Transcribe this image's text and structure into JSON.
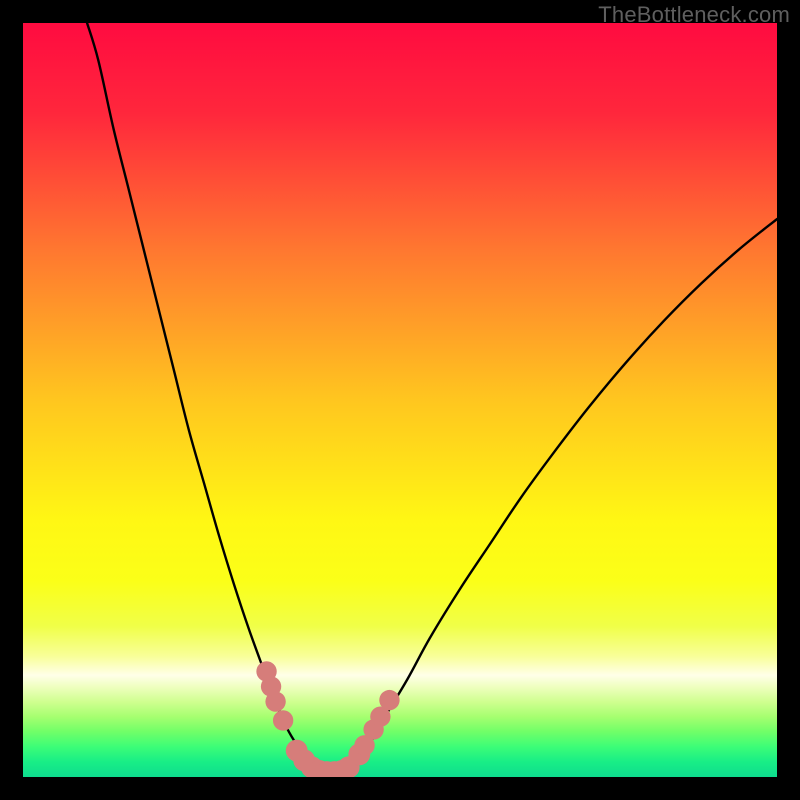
{
  "watermark": "TheBottleneck.com",
  "chart_data": {
    "type": "line",
    "title": "",
    "xlabel": "",
    "ylabel": "",
    "xlim": [
      0,
      100
    ],
    "ylim": [
      0,
      100
    ],
    "gradient_stops": [
      {
        "pct": 0,
        "color": "#ff0b40"
      },
      {
        "pct": 12,
        "color": "#ff273c"
      },
      {
        "pct": 30,
        "color": "#ff7730"
      },
      {
        "pct": 50,
        "color": "#ffc61f"
      },
      {
        "pct": 66,
        "color": "#fff714"
      },
      {
        "pct": 74,
        "color": "#fbff18"
      },
      {
        "pct": 80,
        "color": "#f0ff48"
      },
      {
        "pct": 84,
        "color": "#f8ff99"
      },
      {
        "pct": 86.5,
        "color": "#ffffe8"
      },
      {
        "pct": 88,
        "color": "#efffc0"
      },
      {
        "pct": 90,
        "color": "#d0ff90"
      },
      {
        "pct": 92,
        "color": "#a6ff70"
      },
      {
        "pct": 94,
        "color": "#70ff68"
      },
      {
        "pct": 96,
        "color": "#3cfd77"
      },
      {
        "pct": 98,
        "color": "#18ee86"
      },
      {
        "pct": 100,
        "color": "#0edc8e"
      }
    ],
    "series": [
      {
        "name": "left-curve",
        "x": [
          8.5,
          10,
          12,
          14,
          16,
          18,
          20,
          22,
          24,
          26,
          28,
          30,
          32,
          33.5,
          35,
          36.5,
          38,
          39.3
        ],
        "y": [
          100,
          95,
          86,
          78,
          70,
          62,
          54,
          46,
          39,
          32,
          25.5,
          19.5,
          14,
          10,
          6.5,
          4,
          2,
          0.8
        ]
      },
      {
        "name": "right-curve",
        "x": [
          42.7,
          44,
          46,
          48,
          51,
          54,
          58,
          62,
          66,
          70,
          75,
          80,
          85,
          90,
          95,
          100
        ],
        "y": [
          0.8,
          2,
          4.5,
          8,
          13,
          18.5,
          25,
          31,
          37,
          42.5,
          49,
          55,
          60.5,
          65.5,
          70,
          74
        ]
      }
    ],
    "markers": {
      "name": "bottom-markers",
      "color": "#d67d7a",
      "points": [
        {
          "x": 32.3,
          "y": 14,
          "r": 1.35
        },
        {
          "x": 32.9,
          "y": 12,
          "r": 1.35
        },
        {
          "x": 33.5,
          "y": 10,
          "r": 1.35
        },
        {
          "x": 34.5,
          "y": 7.5,
          "r": 1.35
        },
        {
          "x": 36.3,
          "y": 3.5,
          "r": 1.45
        },
        {
          "x": 37.3,
          "y": 2.2,
          "r": 1.45
        },
        {
          "x": 38.3,
          "y": 1.3,
          "r": 1.45
        },
        {
          "x": 39.3,
          "y": 0.8,
          "r": 1.45
        },
        {
          "x": 40.3,
          "y": 0.65,
          "r": 1.45
        },
        {
          "x": 41.3,
          "y": 0.65,
          "r": 1.45
        },
        {
          "x": 42.3,
          "y": 0.8,
          "r": 1.45
        },
        {
          "x": 43.2,
          "y": 1.3,
          "r": 1.45
        },
        {
          "x": 44.6,
          "y": 3.0,
          "r": 1.45
        },
        {
          "x": 45.3,
          "y": 4.2,
          "r": 1.35
        },
        {
          "x": 46.5,
          "y": 6.3,
          "r": 1.35
        },
        {
          "x": 47.4,
          "y": 8.0,
          "r": 1.35
        },
        {
          "x": 48.6,
          "y": 10.2,
          "r": 1.35
        }
      ]
    }
  }
}
